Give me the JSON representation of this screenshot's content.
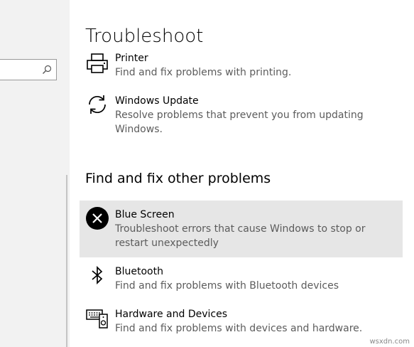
{
  "search": {
    "placeholder": ""
  },
  "page": {
    "title": "Troubleshoot"
  },
  "top_items": [
    {
      "name": "Printer",
      "description": "Find and fix problems with printing.",
      "icon": "printer-icon"
    },
    {
      "name": "Windows Update",
      "description": "Resolve problems that prevent you from updating Windows.",
      "icon": "windows-update-icon"
    }
  ],
  "other_section": {
    "heading": "Find and fix other problems",
    "items": [
      {
        "name": "Blue Screen",
        "description": "Troubleshoot errors that cause Windows to stop or restart unexpectedly",
        "icon": "blue-screen-icon",
        "selected": true
      },
      {
        "name": "Bluetooth",
        "description": "Find and fix problems with Bluetooth devices",
        "icon": "bluetooth-icon"
      },
      {
        "name": "Hardware and Devices",
        "description": "Find and fix problems with devices and hardware.",
        "icon": "hardware-devices-icon"
      }
    ]
  },
  "watermark": "wsxdn.com",
  "colors": {
    "selected_background": "#e6e6e6",
    "sidebar_background": "#f2f2f2",
    "description_text": "#5c5c5c"
  }
}
